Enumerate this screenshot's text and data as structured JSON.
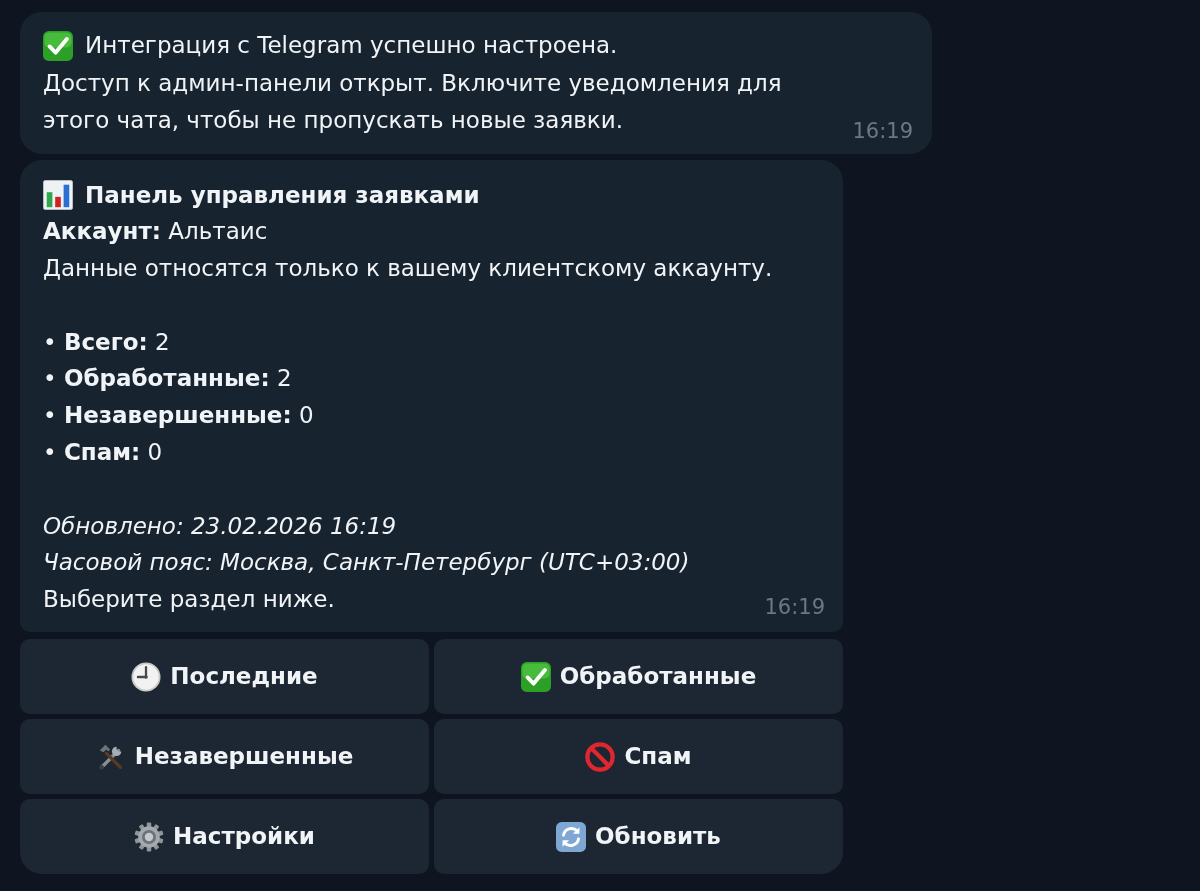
{
  "status_message": {
    "title": "Интеграция с Telegram успешно настроена.",
    "text": "Доступ к админ-панели открыт. Включите уведомления для этого чата, чтобы не пропускать новые заявки.",
    "time": "16:19"
  },
  "dashboard_message": {
    "title": "Панель управления заявками",
    "account": "**Аккаунт:** Альтаис",
    "scope_note": "Данные относятся только к вашему клиентскому аккаунту.",
    "stats": [
      "• **Всего:** 2",
      "• **Обработанные:** 2",
      "• **Незавершенные:** 0",
      "• **Спам:** 0"
    ],
    "updated": "Обновлено: 23.02.2026 16:19",
    "timezone": "Часовой пояс: Москва, Санкт-Петербург (UTC+03:00)",
    "prompt": "Выберите раздел ниже.",
    "time": "16:19"
  },
  "keyboard": {
    "rows": [
      {
        "buttons": [
          {
            "label": "Последние"
          },
          {
            "label": "Обработанные"
          }
        ]
      },
      {
        "buttons": [
          {
            "label": "Незавершенные"
          },
          {
            "label": "Спам"
          }
        ]
      },
      {
        "buttons": [
          {
            "label": "Настройки"
          },
          {
            "label": "Обновить"
          }
        ]
      }
    ]
  }
}
